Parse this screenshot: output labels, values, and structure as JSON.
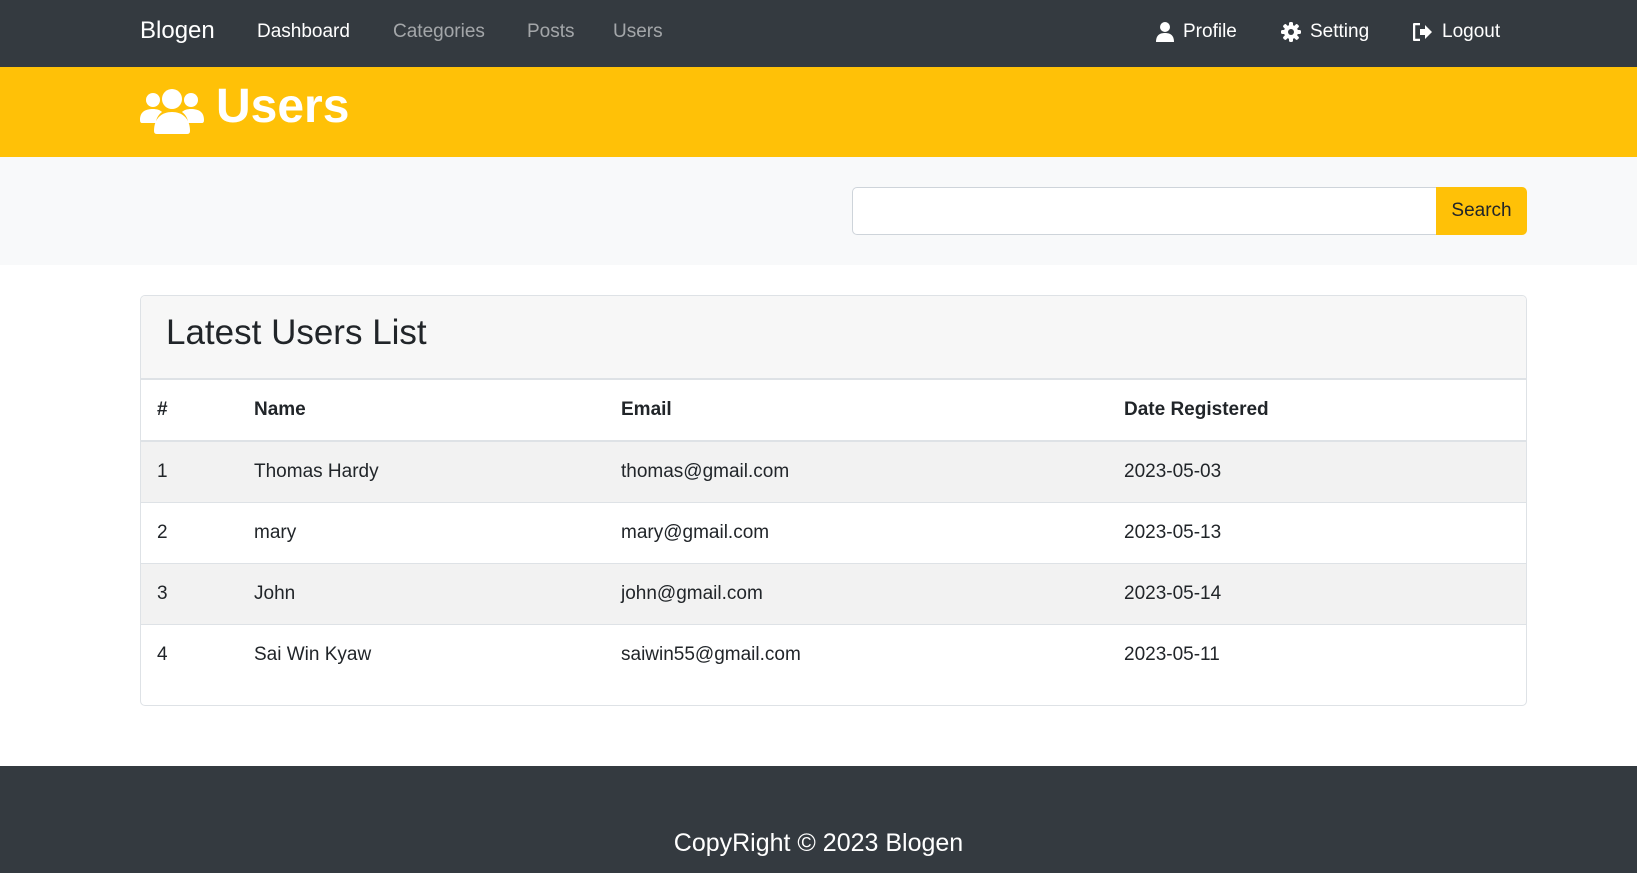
{
  "navbar": {
    "brand": "Blogen",
    "links": [
      {
        "label": "Dashboard",
        "active": true
      },
      {
        "label": "Categories",
        "active": false
      },
      {
        "label": "Posts",
        "active": false
      },
      {
        "label": "Users",
        "active": false
      }
    ],
    "right": [
      {
        "label": "Profile",
        "icon": "user-icon"
      },
      {
        "label": "Setting",
        "icon": "gear-icon"
      },
      {
        "label": "Logout",
        "icon": "logout-icon"
      }
    ]
  },
  "header": {
    "title": "Users",
    "icon": "users-icon"
  },
  "search": {
    "value": "",
    "placeholder": "",
    "button_label": "Search"
  },
  "users_card": {
    "title": "Latest Users List",
    "columns": [
      "#",
      "Name",
      "Email",
      "Date Registered"
    ],
    "rows": [
      {
        "num": "1",
        "name": "Thomas Hardy",
        "email": "thomas@gmail.com",
        "date": "2023-05-03"
      },
      {
        "num": "2",
        "name": "mary",
        "email": "mary@gmail.com",
        "date": "2023-05-13"
      },
      {
        "num": "3",
        "name": "John",
        "email": "john@gmail.com",
        "date": "2023-05-14"
      },
      {
        "num": "4",
        "name": "Sai Win Kyaw",
        "email": "saiwin55@gmail.com",
        "date": "2023-05-11"
      }
    ]
  },
  "footer": {
    "text": "CopyRight © 2023 Blogen"
  },
  "colors": {
    "navbar_bg": "#343a40",
    "accent": "#ffc107",
    "search_section_bg": "#f8f9fa",
    "row_stripe": "#f2f2f2"
  }
}
